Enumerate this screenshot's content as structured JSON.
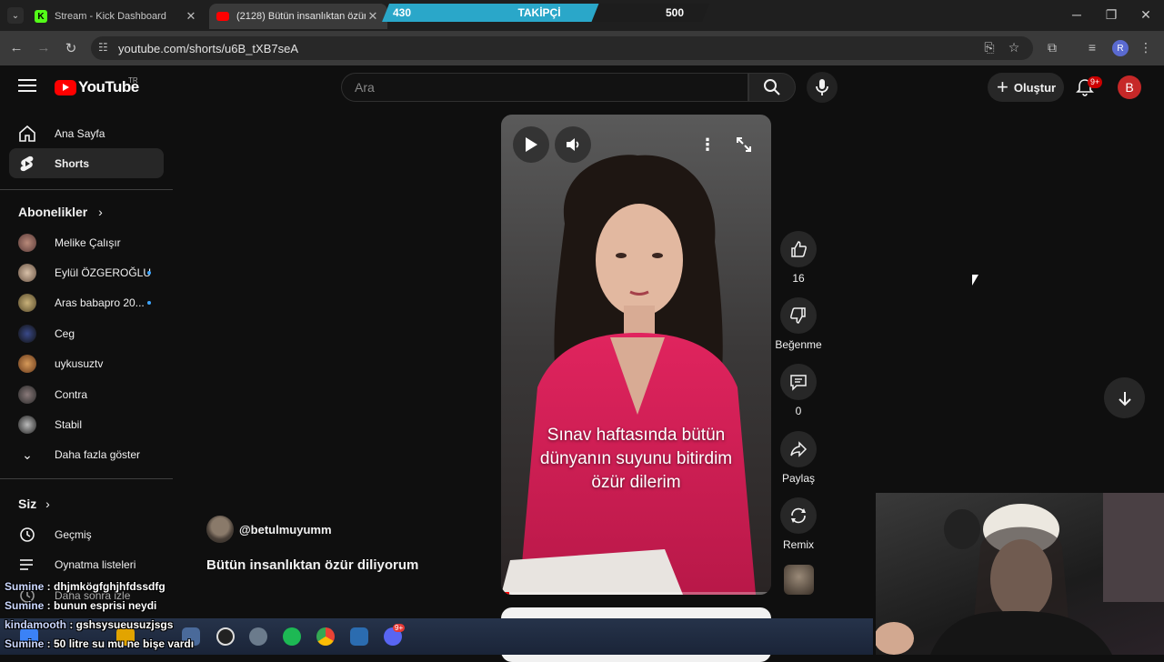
{
  "browser": {
    "tabs": [
      {
        "title": "Stream - Kick Dashboard",
        "icon": "kick-icon"
      },
      {
        "title": "(2128) Bütün insanlıktan özür d",
        "icon": "youtube-icon"
      }
    ],
    "url": "youtube.com/shorts/u6B_tXB7seA",
    "profile_initial": "R"
  },
  "follower_goal": {
    "current": "430",
    "label": "TAKİPÇİ",
    "target": "500",
    "progress": 0.67
  },
  "header": {
    "logo_text": "YouTube",
    "region": "TR",
    "search_placeholder": "Ara",
    "create_label": "Oluştur",
    "notif_badge": "9+",
    "avatar_initial": "B"
  },
  "sidebar": {
    "main": [
      {
        "label": "Ana Sayfa",
        "icon": "home-icon"
      },
      {
        "label": "Shorts",
        "icon": "shorts-icon"
      }
    ],
    "subs_header": "Abonelikler",
    "subscriptions": [
      {
        "label": "Melike Çalışır",
        "dot": false
      },
      {
        "label": "Eylül ÖZGEROĞLU",
        "dot": true
      },
      {
        "label": "Aras babapro 20...",
        "dot": true
      },
      {
        "label": "Ceg",
        "dot": false
      },
      {
        "label": "uykusuztv",
        "dot": false
      },
      {
        "label": "Contra",
        "dot": false
      },
      {
        "label": "Stabil",
        "dot": false
      }
    ],
    "show_more": "Daha fazla göster",
    "you_header": "Siz",
    "you_items": [
      {
        "label": "Geçmiş",
        "icon": "history-icon"
      },
      {
        "label": "Oynatma listeleri",
        "icon": "playlist-icon"
      },
      {
        "label": "Daha sonra izle",
        "icon": "watch-later-icon"
      }
    ]
  },
  "short": {
    "caption": [
      "Sınav haftasında bütün",
      "dünyanın suyunu bitirdim",
      "özür dilerim"
    ],
    "channel": "@betulmuyumm",
    "title": "Bütün insanlıktan özür diliyorum",
    "progress": 0.03,
    "actions": {
      "like_count": "16",
      "dislike_label": "Beğenme",
      "comment_count": "0",
      "share_label": "Paylaş",
      "remix_label": "Remix"
    }
  },
  "chat": [
    {
      "user": "Sumine",
      "msg": " : dhjmkögfghjhfdssdfg"
    },
    {
      "user": "Sumine",
      "msg": " : bunun esprisi neydi"
    },
    {
      "user": "kindamooth",
      "msg": " : gshsysueusuzjsgs"
    },
    {
      "user": "Sumine",
      "msg": " : 50 litre su mu ne bişe vardı"
    }
  ],
  "taskbar": {
    "discord_badge": "9+"
  }
}
